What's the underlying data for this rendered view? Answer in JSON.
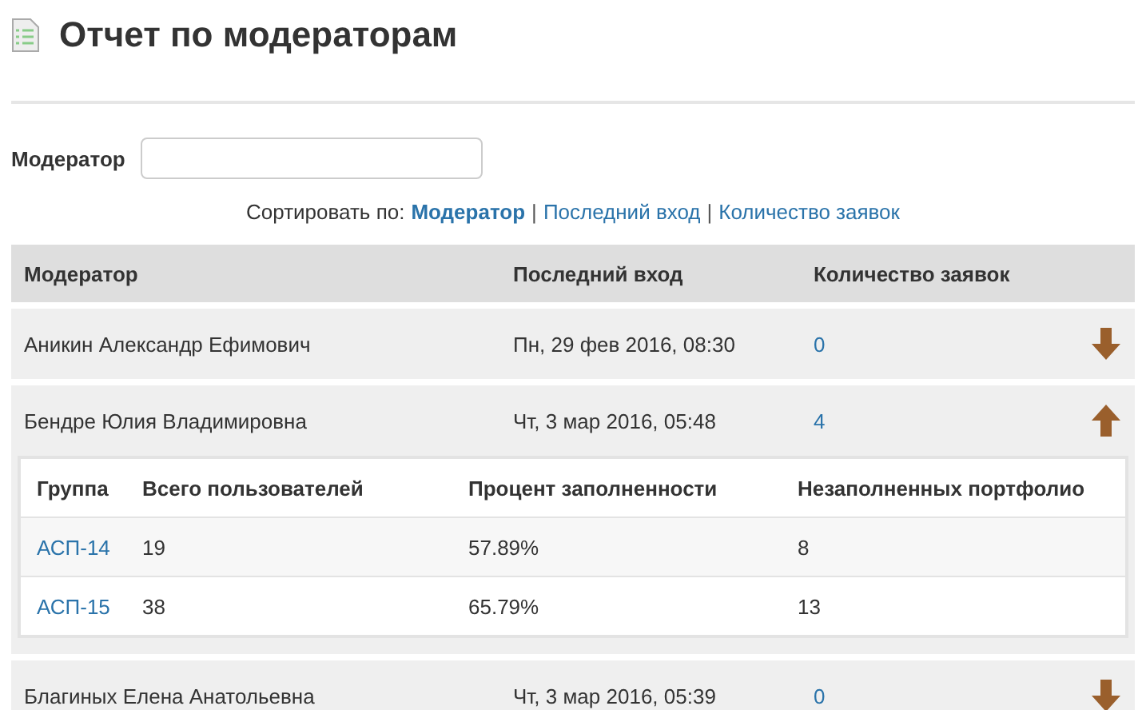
{
  "page": {
    "title": "Отчет по модераторам"
  },
  "filter": {
    "label": "Модератор"
  },
  "sort": {
    "label": "Сортировать по:",
    "separators": [
      "|",
      "|"
    ],
    "options": [
      {
        "label": "Модератор",
        "selected": true
      },
      {
        "label": "Последний вход",
        "selected": false
      },
      {
        "label": "Количество заявок",
        "selected": false
      }
    ]
  },
  "table": {
    "columns": [
      "Модератор",
      "Последний вход",
      "Количество заявок"
    ],
    "rows": [
      {
        "name": "Аникин Александр Ефимович",
        "last_login": "Пн, 29 фев 2016, 08:30",
        "requests": "0",
        "expanded": false
      },
      {
        "name": "Бендре Юлия Владимировна",
        "last_login": "Чт, 3 мар 2016, 05:48",
        "requests": "4",
        "expanded": true,
        "groups": {
          "columns": [
            "Группа",
            "Всего пользователей",
            "Процент заполненности",
            "Незаполненных портфолио"
          ],
          "rows": [
            {
              "group": "АСП-14",
              "total": "19",
              "percent": "57.89%",
              "empty": "8"
            },
            {
              "group": "АСП-15",
              "total": "38",
              "percent": "65.79%",
              "empty": "13"
            }
          ]
        }
      },
      {
        "name": "Благиных Елена Анатольевна",
        "last_login": "Чт, 3 мар 2016, 05:39",
        "requests": "0",
        "expanded": false
      }
    ]
  }
}
